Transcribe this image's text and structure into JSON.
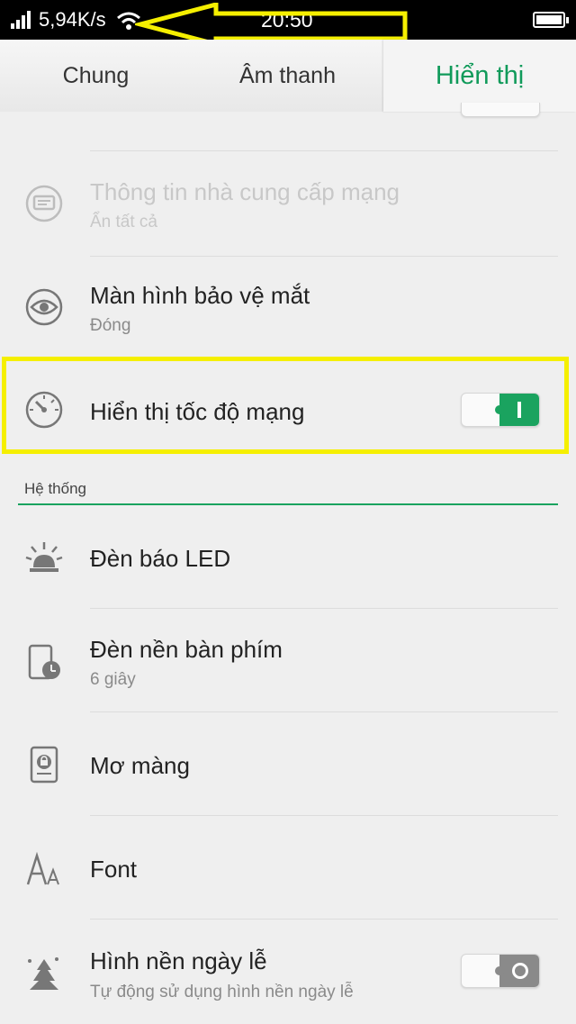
{
  "status_bar": {
    "speed": "5,94K/s",
    "time": "20:50"
  },
  "tabs": [
    {
      "label": "Chung",
      "active": false
    },
    {
      "label": "Âm thanh",
      "active": false
    },
    {
      "label": "Hiển thị",
      "active": true
    }
  ],
  "rows": {
    "carrier_info": {
      "title": "Thông tin nhà cung cấp mạng",
      "subtitle": "Ẩn tất cả",
      "enabled": false,
      "icon": "message-icon"
    },
    "eye_protection": {
      "title": "Màn hình bảo vệ mắt",
      "subtitle": "Đóng",
      "icon": "eye-icon"
    },
    "network_speed": {
      "title": "Hiển thị tốc độ mạng",
      "toggle_on": true,
      "icon": "speedometer-icon"
    }
  },
  "section": {
    "title": "Hệ thống"
  },
  "system_rows": {
    "led": {
      "title": "Đèn báo LED",
      "icon": "led-light-icon"
    },
    "keyboard_backlight": {
      "title": "Đèn nền bàn phím",
      "subtitle": "6 giây",
      "icon": "tablet-clock-icon"
    },
    "daydream": {
      "title": "Mơ màng",
      "icon": "daydream-icon"
    },
    "font": {
      "title": "Font",
      "icon": "font-icon"
    },
    "holiday_wallpaper": {
      "title": "Hình nền ngày lễ",
      "subtitle": "Tự động sử dụng hình nền ngày lễ",
      "toggle_on": false,
      "icon": "christmas-tree-icon"
    }
  },
  "colors": {
    "accent": "#1aa35f",
    "highlight": "#f5ef00"
  }
}
